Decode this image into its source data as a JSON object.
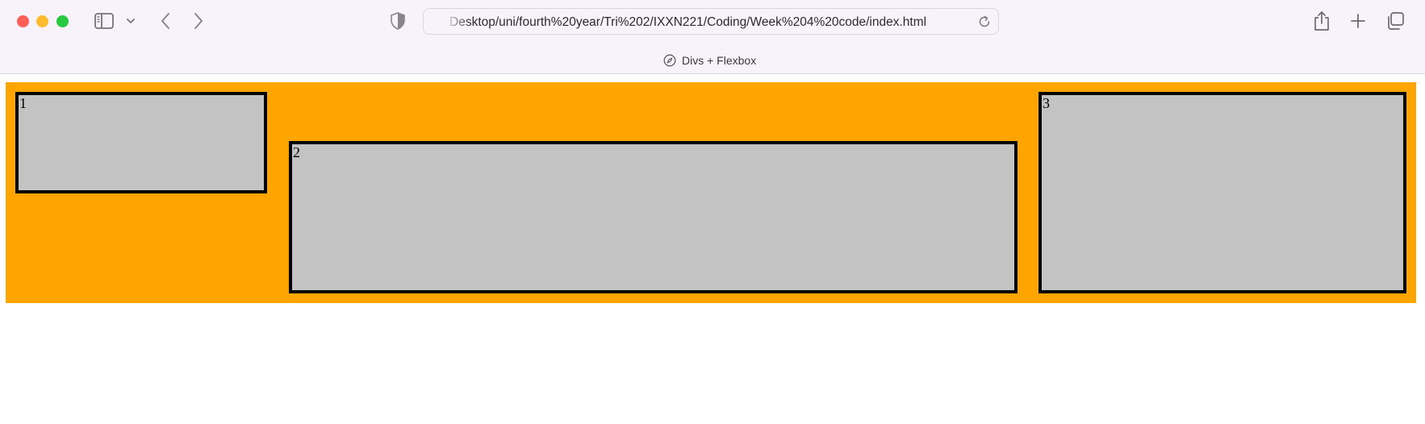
{
  "browser": {
    "url": "Desktop/uni/fourth%20year/Tri%202/IXXN221/Coding/Week%204%20code/index.html",
    "tab_title": "Divs + Flexbox",
    "icons": {
      "close": "close-traffic-light",
      "minimize": "minimize-traffic-light",
      "zoom": "zoom-traffic-light",
      "sidebar": "sidebar-icon",
      "chevron": "chevron-down-icon",
      "back": "chevron-left-icon",
      "forward": "chevron-right-icon",
      "privacy": "shield-icon",
      "reload": "reload-icon",
      "share": "share-icon",
      "new_tab": "plus-icon",
      "tab_overview": "tab-overview-icon",
      "tab_favicon": "compass-icon"
    },
    "colors": {
      "close": "#fe5f57",
      "minimize": "#febc2e",
      "zoom": "#28c840",
      "chrome_background": "#f8f3fa"
    }
  },
  "page": {
    "container_color": "#ffa500",
    "box_color": "#c3c3c3",
    "boxes": [
      {
        "label": "1"
      },
      {
        "label": "2"
      },
      {
        "label": "3"
      }
    ]
  }
}
